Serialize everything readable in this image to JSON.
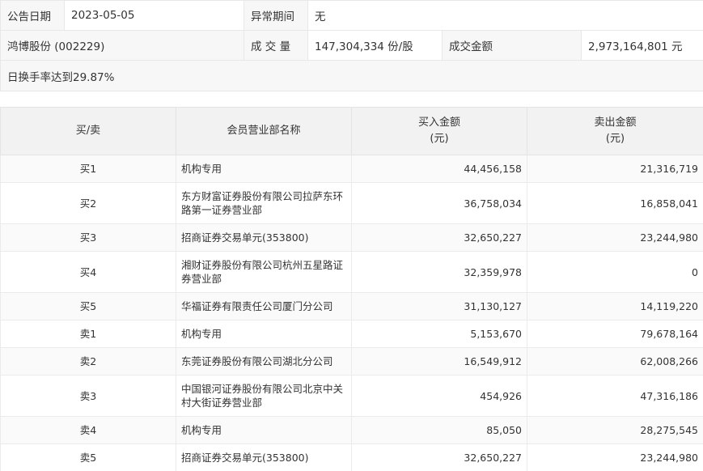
{
  "info": {
    "announce_date_label": "公告日期",
    "announce_date": "2023-05-05",
    "abnormal_period_label": "异常期间",
    "abnormal_period": "无",
    "stock": "鸿博股份 (002229)",
    "volume_label": "成 交 量",
    "volume": "147,304,334 份/股",
    "amount_label": "成交金额",
    "amount": "2,973,164,801 元",
    "reason": "日换手率达到29.87%"
  },
  "table": {
    "headers": {
      "direction": "买/卖",
      "member": "会员营业部名称",
      "buy_amount": "买入金额",
      "buy_unit": "(元)",
      "sell_amount": "卖出金额",
      "sell_unit": "(元)"
    },
    "rows": [
      {
        "direction": "买1",
        "name": "机构专用",
        "buy": "44,456,158",
        "sell": "21,316,719"
      },
      {
        "direction": "买2",
        "name": "东方财富证券股份有限公司拉萨东环路第一证券营业部",
        "buy": "36,758,034",
        "sell": "16,858,041"
      },
      {
        "direction": "买3",
        "name": "招商证券交易单元(353800)",
        "buy": "32,650,227",
        "sell": "23,244,980"
      },
      {
        "direction": "买4",
        "name": "湘财证券股份有限公司杭州五星路证券营业部",
        "buy": "32,359,978",
        "sell": "0"
      },
      {
        "direction": "买5",
        "name": "华福证券有限责任公司厦门分公司",
        "buy": "31,130,127",
        "sell": "14,119,220"
      },
      {
        "direction": "卖1",
        "name": "机构专用",
        "buy": "5,153,670",
        "sell": "79,678,164"
      },
      {
        "direction": "卖2",
        "name": "东莞证券股份有限公司湖北分公司",
        "buy": "16,549,912",
        "sell": "62,008,266"
      },
      {
        "direction": "卖3",
        "name": "中国银河证券股份有限公司北京中关村大街证券营业部",
        "buy": "454,926",
        "sell": "47,316,186"
      },
      {
        "direction": "卖4",
        "name": "机构专用",
        "buy": "85,050",
        "sell": "28,275,545"
      },
      {
        "direction": "卖5",
        "name": "招商证券交易单元(353800)",
        "buy": "32,650,227",
        "sell": "23,244,980"
      }
    ]
  }
}
